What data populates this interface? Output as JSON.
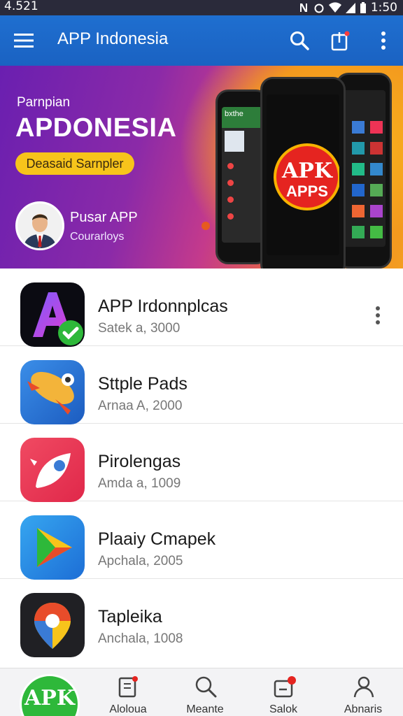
{
  "status_bar": {
    "left_time": "4.521",
    "clock": "1:50"
  },
  "app_bar": {
    "title": "APP Indonesia",
    "menu_icon": "hamburger-icon",
    "search_icon": "search-icon",
    "share_icon": "share-icon",
    "more_icon": "more-vert-icon"
  },
  "banner": {
    "subtitle": "Parnpian",
    "title": "APDONESIA",
    "pill_label": "Deasaid Sarnpler",
    "profile_name": "Pusar APP",
    "profile_sub": "Courarloys",
    "phone_header": "bxthe",
    "badge_top": "APK",
    "badge_bottom": "APPS"
  },
  "apps": [
    {
      "name": "APP Irdonnplcas",
      "meta": "Satek a,  3000",
      "icon": "stylized-a-icon",
      "verified": true
    },
    {
      "name": "Sttple Pads",
      "meta": "Arnaa A,  2000",
      "icon": "rocket-icon"
    },
    {
      "name": "Pirolengas",
      "meta": "Amda a,  1009",
      "icon": "rocket-launch-icon"
    },
    {
      "name": "Plaaiy Cmapek",
      "meta": "Apchala,  2005",
      "icon": "play-triangle-icon"
    },
    {
      "name": "Tapleika",
      "meta": "Anchala,  1008",
      "icon": "location-pin-icon"
    }
  ],
  "bottom_nav": {
    "home_label": "APK",
    "items": [
      {
        "label": "Aloloua",
        "icon": "book-icon"
      },
      {
        "label": "Meante",
        "icon": "search-icon"
      },
      {
        "label": "Salok",
        "icon": "inbox-icon"
      },
      {
        "label": "Abnaris",
        "icon": "person-icon"
      }
    ]
  },
  "colors": {
    "app_bar": "#1f6fd0",
    "pill": "#f7c41b",
    "verified": "#2eb83a",
    "badge": "#e52420"
  }
}
